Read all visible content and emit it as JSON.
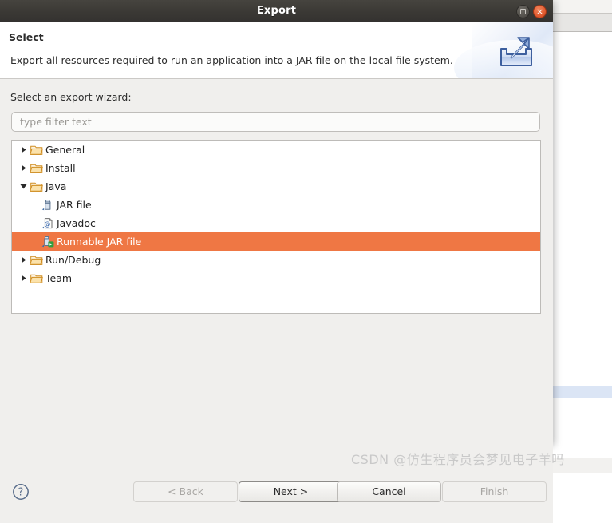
{
  "window": {
    "title": "Export",
    "maximize_icon": "maximize-icon",
    "close_icon": "close-icon",
    "close_glyph": "×"
  },
  "header": {
    "title": "Select",
    "description": "Export all resources required to run an application into a JAR file on the local file system.",
    "icon": "export-wizard-icon"
  },
  "content": {
    "select_label": "Select an export wizard:",
    "filter": {
      "value": "",
      "placeholder": "type filter text"
    },
    "tree": [
      {
        "label": "General",
        "depth": 0,
        "expanded": false,
        "icon": "folder-open-icon",
        "selected": false
      },
      {
        "label": "Install",
        "depth": 0,
        "expanded": false,
        "icon": "folder-open-icon",
        "selected": false
      },
      {
        "label": "Java",
        "depth": 0,
        "expanded": true,
        "icon": "folder-open-icon",
        "selected": false
      },
      {
        "label": "JAR file",
        "depth": 1,
        "expanded": null,
        "icon": "jar-file-icon",
        "selected": false
      },
      {
        "label": "Javadoc",
        "depth": 1,
        "expanded": null,
        "icon": "javadoc-icon",
        "selected": false
      },
      {
        "label": "Runnable JAR file",
        "depth": 1,
        "expanded": null,
        "icon": "runnable-jar-file-icon",
        "selected": true
      },
      {
        "label": "Run/Debug",
        "depth": 0,
        "expanded": false,
        "icon": "folder-open-icon",
        "selected": false
      },
      {
        "label": "Team",
        "depth": 0,
        "expanded": false,
        "icon": "folder-open-icon",
        "selected": false
      }
    ]
  },
  "buttons": {
    "help": "help-icon",
    "back": {
      "label": "< Back",
      "enabled": false,
      "default": false
    },
    "next": {
      "label": "Next >",
      "enabled": true,
      "default": true
    },
    "cancel": {
      "label": "Cancel",
      "enabled": true,
      "default": false
    },
    "finish": {
      "label": "Finish",
      "enabled": false,
      "default": false
    }
  },
  "watermark": "CSDN @仿生程序员会梦见电子羊吗",
  "colors": {
    "titlebar": "#3b3935",
    "selection": "#ef7744",
    "close_button": "#e25c31",
    "dialog_bg": "#f0efed",
    "folder_icon": "#e8a33d"
  }
}
